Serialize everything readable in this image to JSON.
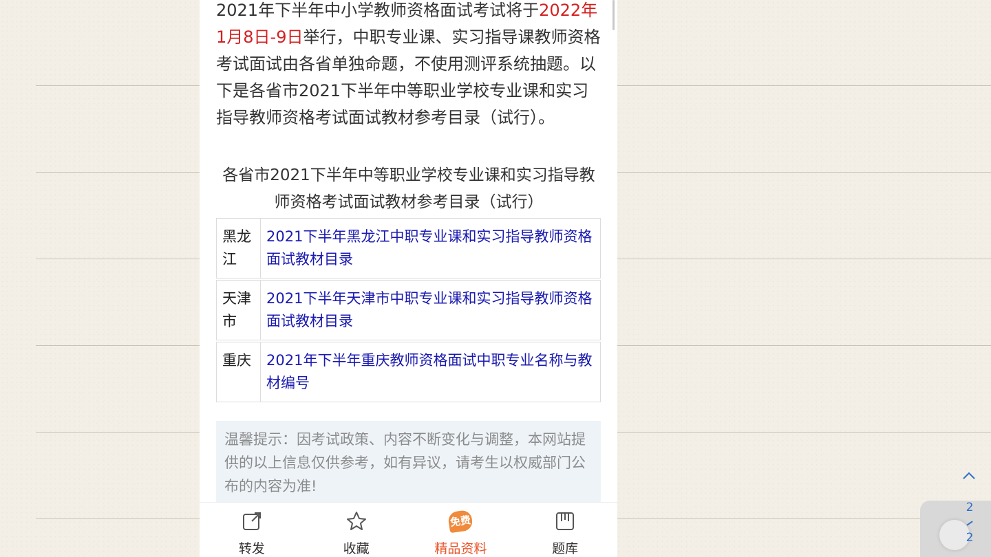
{
  "article": {
    "intro_part1": "2021年下半年中小学教师资格面试考试将于",
    "intro_date": "2022年1月8日-9日",
    "intro_part2": "举行，中职专业课、实习指导课教师资格考试面试由各省单独命题，不使用测评系统抽题。以下是各省市2021下半年中等职业学校专业课和实习指导教师资格考试面试教材参考目录（试行）。",
    "section_title": "各省市2021下半年中等职业学校专业课和实习指导教师资格考试面试教材参考目录（试行）",
    "highlight_color": "#d42020",
    "link_color": "#1a1ab0"
  },
  "catalog": [
    {
      "province": "黑龙江",
      "link": "2021下半年黑龙江中职专业课和实习指导教师资格面试教材目录"
    },
    {
      "province": "天津市",
      "link": "2021下半年天津市中职专业课和实习指导教师资格面试教材目录"
    },
    {
      "province": "重庆",
      "link": "2021年下半年重庆教师资格面试中职专业名称与教材编号"
    }
  ],
  "tip": {
    "text": "温馨提示：因考试政策、内容不断变化与调整，本网站提供的以上信息仅供参考，如有异议，请考生以权威部门公布的内容为准!"
  },
  "bottom_nav": {
    "items": [
      {
        "label": "转发",
        "icon": "share-icon"
      },
      {
        "label": "收藏",
        "icon": "star-icon"
      },
      {
        "label": "精品资料",
        "icon": "free-badge-icon",
        "badge_text": "免费",
        "active": true
      },
      {
        "label": "题库",
        "icon": "question-bank-icon"
      }
    ],
    "active_color": "#e8552a"
  },
  "pager": {
    "current": "2",
    "total": "2"
  }
}
